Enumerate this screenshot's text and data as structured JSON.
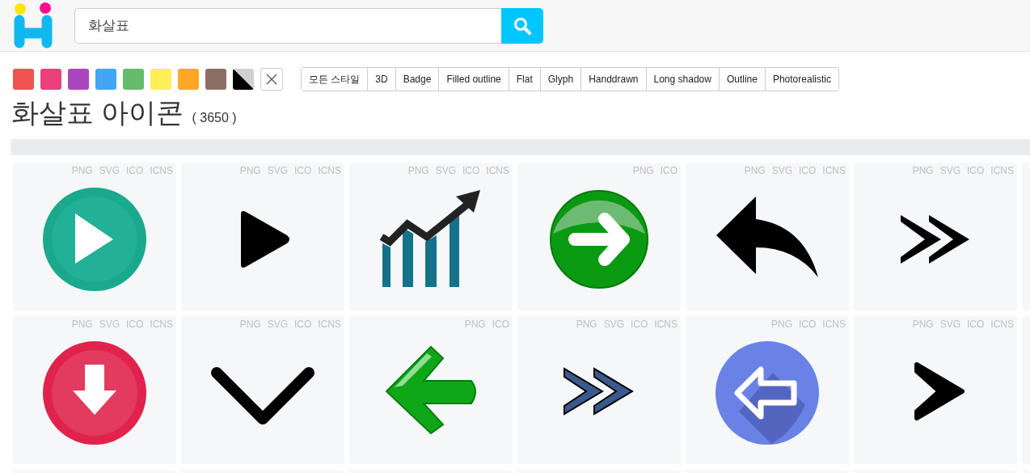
{
  "search": {
    "value": "화살표"
  },
  "colors": [
    {
      "color": "#ef5350"
    },
    {
      "color": "#ec407a"
    },
    {
      "color": "#ab47bc"
    },
    {
      "color": "#42a5f5"
    },
    {
      "color": "#66bb6a"
    },
    {
      "color": "#ffee58"
    },
    {
      "color": "#ffa726"
    },
    {
      "color": "#8d6e63"
    },
    {
      "color": "#000000"
    }
  ],
  "styles": [
    "모든 스타일",
    "3D",
    "Badge",
    "Filled outline",
    "Flat",
    "Glyph",
    "Handdrawn",
    "Long shadow",
    "Outline",
    "Photorealistic"
  ],
  "title": "화살표 아이콘",
  "count": "( 3650 )",
  "icons": [
    {
      "kind": "play-circle",
      "formats": [
        "PNG",
        "SVG",
        "ICO",
        "ICNS"
      ]
    },
    {
      "kind": "play",
      "formats": [
        "PNG",
        "SVG",
        "ICO",
        "ICNS"
      ]
    },
    {
      "kind": "chart-up",
      "formats": [
        "PNG",
        "SVG",
        "ICO",
        "ICNS"
      ]
    },
    {
      "kind": "glossy-right",
      "formats": [
        "PNG",
        "ICO"
      ]
    },
    {
      "kind": "reply",
      "formats": [
        "PNG",
        "SVG",
        "ICO",
        "ICNS"
      ]
    },
    {
      "kind": "double-chevron",
      "formats": [
        "PNG",
        "SVG",
        "ICO",
        "ICNS"
      ]
    },
    {
      "kind": "down-circle",
      "formats": [
        "PNG",
        "SVG",
        "ICO",
        "ICNS"
      ]
    },
    {
      "kind": "chevron-down",
      "formats": [
        "PNG",
        "SVG",
        "ICO",
        "ICNS"
      ]
    },
    {
      "kind": "glossy-left",
      "formats": [
        "PNG",
        "ICO"
      ]
    },
    {
      "kind": "double-chevron-blue",
      "formats": [
        "PNG",
        "SVG",
        "ICO",
        "ICNS"
      ]
    },
    {
      "kind": "left-circle",
      "formats": [
        "PNG",
        "ICO",
        "ICNS"
      ]
    },
    {
      "kind": "chevron-right",
      "formats": [
        "PNG",
        "SVG",
        "ICO",
        "ICNS"
      ]
    }
  ]
}
